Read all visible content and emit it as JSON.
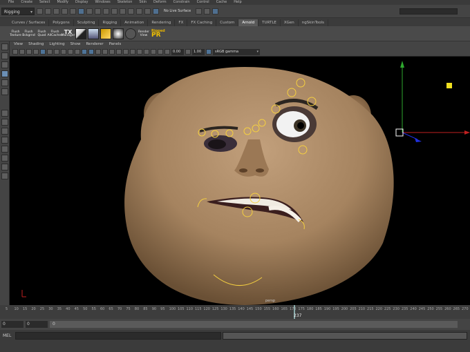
{
  "menus": [
    "File",
    "Create",
    "Select",
    "Modify",
    "Display",
    "Windows",
    "Skeleton",
    "Skin",
    "Deform",
    "Constrain",
    "Control",
    "Cache",
    "Help"
  ],
  "status": {
    "mode": "Rigging",
    "live_surface": "No Live Surface"
  },
  "shelf_tabs": [
    "Curves / Surfaces",
    "Polygons",
    "Sculpting",
    "Rigging",
    "Animation",
    "Rendering",
    "FX",
    "FX Caching",
    "Custom",
    "Arnold",
    "TURTLE",
    "XGen",
    "ngSkinTools"
  ],
  "active_shelf_tab": "Arnold",
  "shelf_buttons": [
    {
      "line1": "Flush",
      "line2": "Texture"
    },
    {
      "line1": "Flush",
      "line2": "Bckgrnd"
    },
    {
      "line1": "Flush",
      "line2": "Quad"
    },
    {
      "line1": "Flush",
      "line2": "AllCaches"
    }
  ],
  "tx_manager": {
    "big": "TX",
    "small": "Manager"
  },
  "render_view": {
    "line1": "Render",
    "line2": "View"
  },
  "ipr": {
    "small": "Ripped",
    "big": "PR"
  },
  "view_menu": [
    "View",
    "Shading",
    "Lighting",
    "Show",
    "Renderer",
    "Panels"
  ],
  "exposure": "0.00",
  "gamma": "1.00",
  "colorspace": "sRGB gamma",
  "camera_label": "persp",
  "timeline": {
    "ticks": [
      "5",
      "10",
      "15",
      "20",
      "25",
      "30",
      "35",
      "40",
      "45",
      "50",
      "55",
      "60",
      "65",
      "70",
      "75",
      "80",
      "85",
      "90",
      "95",
      "100",
      "105",
      "110",
      "115",
      "120",
      "125",
      "130",
      "135",
      "140",
      "145",
      "150",
      "155",
      "160",
      "165",
      "170",
      "175",
      "180",
      "185",
      "190",
      "195",
      "200",
      "205",
      "210",
      "215",
      "220",
      "225",
      "230",
      "235",
      "240",
      "245",
      "250",
      "255",
      "260",
      "265",
      "270"
    ],
    "current_frame": "237"
  },
  "range": {
    "start": "0",
    "anim_start": "0",
    "slider_value": "0"
  },
  "command_line": {
    "label": "MEL"
  },
  "colors": {
    "skin": "#a88562",
    "rig_control": "#f5d040",
    "axis_y": "#2ea82e",
    "axis_x": "#c02020",
    "axis_z": "#2030e0"
  }
}
